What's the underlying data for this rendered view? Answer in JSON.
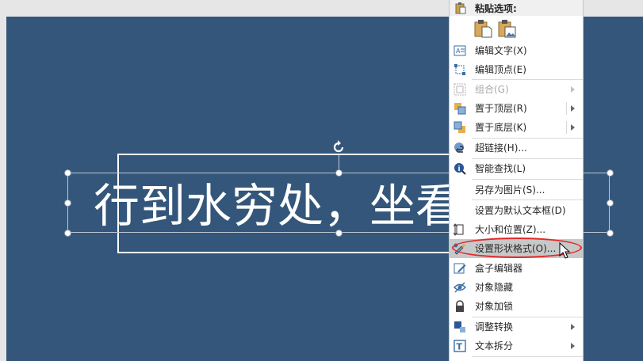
{
  "slide": {
    "text": "行到水穷处，坐看"
  },
  "context_menu": {
    "paste_header": "粘贴选项:",
    "items": [
      {
        "label": "编辑文字(X)",
        "icon": "edit-text-icon"
      },
      {
        "label": "编辑顶点(E)",
        "icon": "edit-points-icon"
      },
      {
        "label": "组合(G)",
        "icon": "group-icon",
        "disabled": true,
        "submenu": true
      },
      {
        "label": "置于顶层(R)",
        "icon": "bring-to-front-icon",
        "submenu": true
      },
      {
        "label": "置于底层(K)",
        "icon": "send-to-back-icon",
        "submenu": true
      },
      {
        "label": "超链接(H)...",
        "icon": "hyperlink-icon"
      },
      {
        "label": "智能查找(L)",
        "icon": "smart-lookup-icon"
      },
      {
        "label": "另存为图片(S)...",
        "icon": ""
      },
      {
        "label": "设置为默认文本框(D)",
        "icon": ""
      },
      {
        "label": "大小和位置(Z)...",
        "icon": "size-position-icon"
      },
      {
        "label": "设置形状格式(O)...",
        "icon": "format-shape-icon",
        "highlighted": true
      },
      {
        "label": "盒子编辑器",
        "icon": "box-editor-icon"
      },
      {
        "label": "对象隐藏",
        "icon": "hide-object-icon"
      },
      {
        "label": "对象加锁",
        "icon": "lock-object-icon"
      },
      {
        "label": "调整转换",
        "icon": "convert-icon",
        "submenu": true
      },
      {
        "label": "文本拆分",
        "icon": "split-text-icon",
        "submenu": true
      }
    ]
  },
  "colors": {
    "slide_background": "#34567a",
    "highlight_ellipse": "#e02a2a",
    "menu_hover": "#c8c8c8"
  }
}
